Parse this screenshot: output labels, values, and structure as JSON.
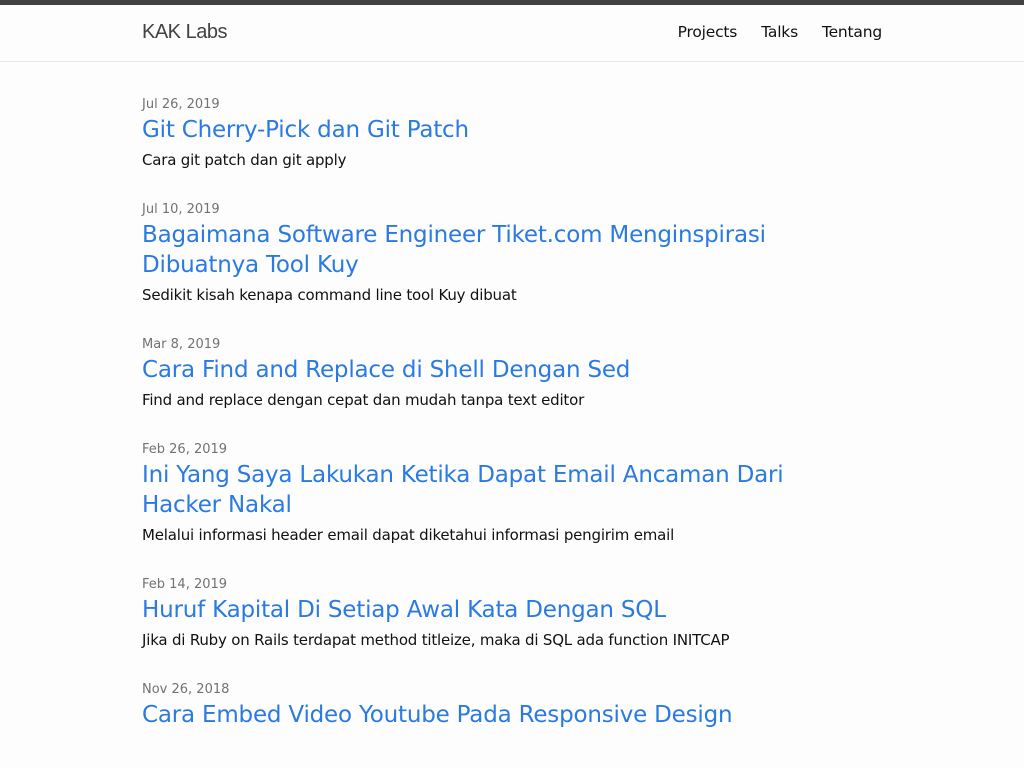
{
  "header": {
    "site_title": "KAK Labs",
    "nav": [
      {
        "label": "Projects"
      },
      {
        "label": "Talks"
      },
      {
        "label": "Tentang"
      }
    ]
  },
  "posts": [
    {
      "date": "Jul 26, 2019",
      "title": "Git Cherry-Pick dan Git Patch",
      "excerpt": "Cara git patch dan git apply"
    },
    {
      "date": "Jul 10, 2019",
      "title": "Bagaimana Software Engineer Tiket.com Menginspirasi Dibuatnya Tool Kuy",
      "excerpt": "Sedikit kisah kenapa command line tool Kuy dibuat"
    },
    {
      "date": "Mar 8, 2019",
      "title": "Cara Find and Replace di Shell Dengan Sed",
      "excerpt": "Find and replace dengan cepat dan mudah tanpa text editor"
    },
    {
      "date": "Feb 26, 2019",
      "title": "Ini Yang Saya Lakukan Ketika Dapat Email Ancaman Dari Hacker Nakal",
      "excerpt": "Melalui informasi header email dapat diketahui informasi pengirim email"
    },
    {
      "date": "Feb 14, 2019",
      "title": "Huruf Kapital Di Setiap Awal Kata Dengan SQL",
      "excerpt": "Jika di Ruby on Rails terdapat method titleize, maka di SQL ada function INITCAP"
    },
    {
      "date": "Nov 26, 2018",
      "title": "Cara Embed Video Youtube Pada Responsive Design",
      "excerpt": ""
    }
  ],
  "colors": {
    "link": "#2a7ae2",
    "top_strip": "#424242",
    "date_text": "#727272"
  }
}
